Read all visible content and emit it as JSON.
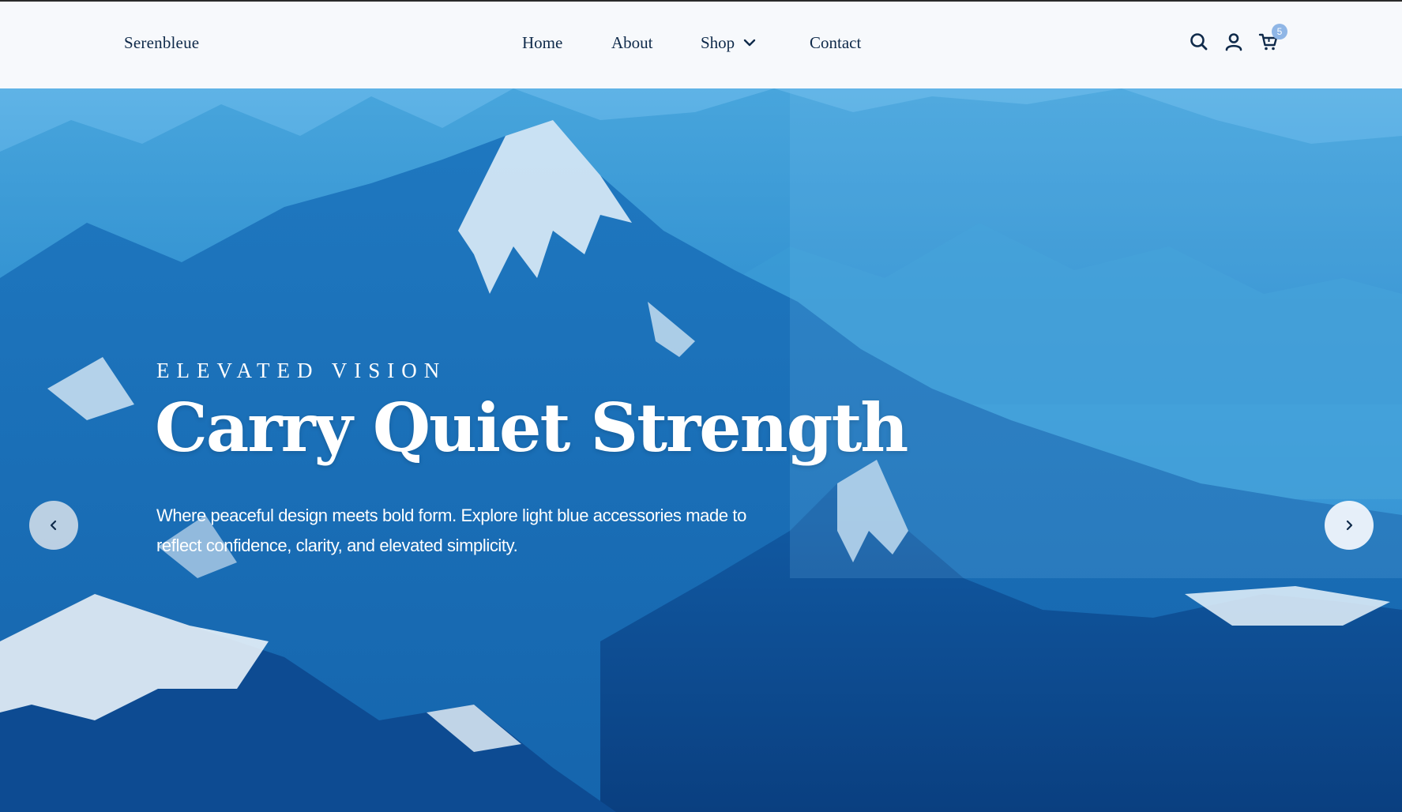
{
  "header": {
    "brand": "Serenbleue",
    "nav": {
      "home": "Home",
      "about": "About",
      "shop": "Shop",
      "contact": "Contact"
    },
    "icons": {
      "search": "search-icon",
      "account": "user-icon",
      "cart": "cart-icon"
    },
    "cart_count": "5"
  },
  "hero": {
    "eyebrow": "ELEVATED VISION",
    "headline": "Carry Quiet Strength",
    "description": "Where peaceful design meets bold form. Explore light blue accessories made to reflect confidence, clarity, and elevated simplicity.",
    "prev_icon": "chevron-left-icon",
    "next_icon": "chevron-right-icon"
  },
  "colors": {
    "text_dark": "#0f2a4a",
    "header_bg": "#f7f9fc",
    "badge": "#8fb6e6",
    "hero_blue": "#1e78c0"
  }
}
